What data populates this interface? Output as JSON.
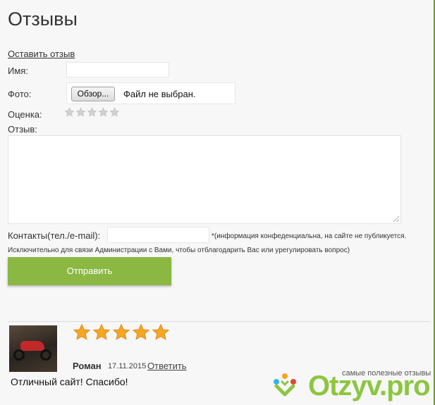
{
  "page": {
    "title": "Отзывы"
  },
  "form": {
    "leave_review_link": "Оставить отзыв",
    "name_label": "Имя:",
    "name_value": "",
    "photo_label": "Фото:",
    "browse_button": "Обзор...",
    "file_status": "Файл не выбран.",
    "rating_label": "Оценка:",
    "rating_value": 0,
    "rating_max": 5,
    "review_label": "Отзыв:",
    "review_value": "",
    "contacts_label": "Контакты(тел./e-mail):",
    "contacts_value": "",
    "contacts_note": "*(информация конфеденциальна, на сайте не публикуется.",
    "contacts_note2": "Исключительно для связи Администрации с Вами, чтобы отблагодарить Вас или урегулировать вопрос)",
    "submit_button": "Отправить"
  },
  "reviews": [
    {
      "rating": 5,
      "author": "Роман",
      "date": "17.11.2015",
      "reply_link": "Ответить",
      "text": "Отличный сайт! Спасибо!"
    }
  ],
  "watermark": {
    "tagline": "самые полезные отзывы",
    "logo_text": "Otzyv.pro"
  },
  "colors": {
    "accent_green": "#8bb843",
    "star_gold": "#f5a623",
    "star_empty": "#d0d0d0",
    "logo_green": "#8cc63f"
  }
}
